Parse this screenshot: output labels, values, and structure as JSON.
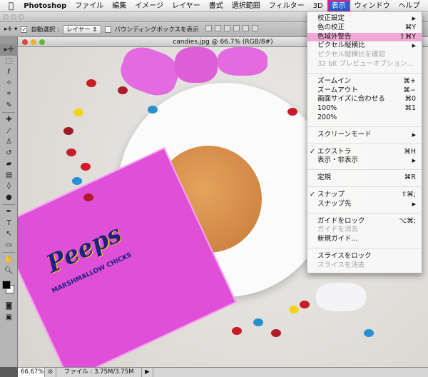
{
  "menubar": {
    "app": "Photoshop",
    "items": [
      "ファイル",
      "編集",
      "イメージ",
      "レイヤー",
      "書式",
      "選択範囲",
      "フィルター",
      "3D",
      "表示",
      "ウィンドウ",
      "ヘルプ"
    ],
    "active": "表示"
  },
  "options": {
    "auto_select_label": "自動選択 :",
    "auto_select_value": "レイヤー",
    "bounding_box_label": "バウンディングボックスを表示",
    "auto_select_checked": true,
    "bounding_box_checked": false
  },
  "document": {
    "title": "candies.jpg @ 66.7% (RGB/8#)"
  },
  "status": {
    "zoom": "66.67%",
    "file": "ファイル : 3.75M/3.75M"
  },
  "view_menu": {
    "groups": [
      [
        {
          "label": "校正設定",
          "shortcut": "",
          "submenu": true
        },
        {
          "label": "色の校正",
          "shortcut": "⌘Y"
        },
        {
          "label": "色域外警告",
          "shortcut": "⇧⌘Y",
          "highlighted": true
        },
        {
          "label": "ピクセル縦横比",
          "shortcut": "",
          "submenu": true
        },
        {
          "label": "ピクセル縦横比を確認",
          "disabled": true
        },
        {
          "label": "32 bit プレビューオプション...",
          "disabled": true
        }
      ],
      [
        {
          "label": "ズームイン",
          "shortcut": "⌘+"
        },
        {
          "label": "ズームアウト",
          "shortcut": "⌘−"
        },
        {
          "label": "画面サイズに合わせる",
          "shortcut": "⌘0"
        },
        {
          "label": "100%",
          "shortcut": "⌘1"
        },
        {
          "label": "200%",
          "shortcut": ""
        }
      ],
      [
        {
          "label": "スクリーンモード",
          "submenu": true
        }
      ],
      [
        {
          "label": "エクストラ",
          "shortcut": "⌘H",
          "checked": true
        },
        {
          "label": "表示・非表示",
          "submenu": true
        }
      ],
      [
        {
          "label": "定規",
          "shortcut": "⌘R"
        }
      ],
      [
        {
          "label": "スナップ",
          "shortcut": "⇧⌘;",
          "checked": true
        },
        {
          "label": "スナップ先",
          "submenu": true
        }
      ],
      [
        {
          "label": "ガイドをロック",
          "shortcut": "⌥⌘;"
        },
        {
          "label": "ガイドを消去",
          "disabled": true
        },
        {
          "label": "新規ガイド..."
        }
      ],
      [
        {
          "label": "スライスをロック"
        },
        {
          "label": "スライスを消去",
          "disabled": true
        }
      ]
    ]
  },
  "image": {
    "package_brand": "Peeps",
    "package_sub": "MARSHMALLOW CHICKS"
  },
  "colors": {
    "menu_highlight": "#f0a8d4",
    "active_menu": "#2a5fd8",
    "peeps_pink": "#e04fd8",
    "cookie": "#d9904a"
  }
}
